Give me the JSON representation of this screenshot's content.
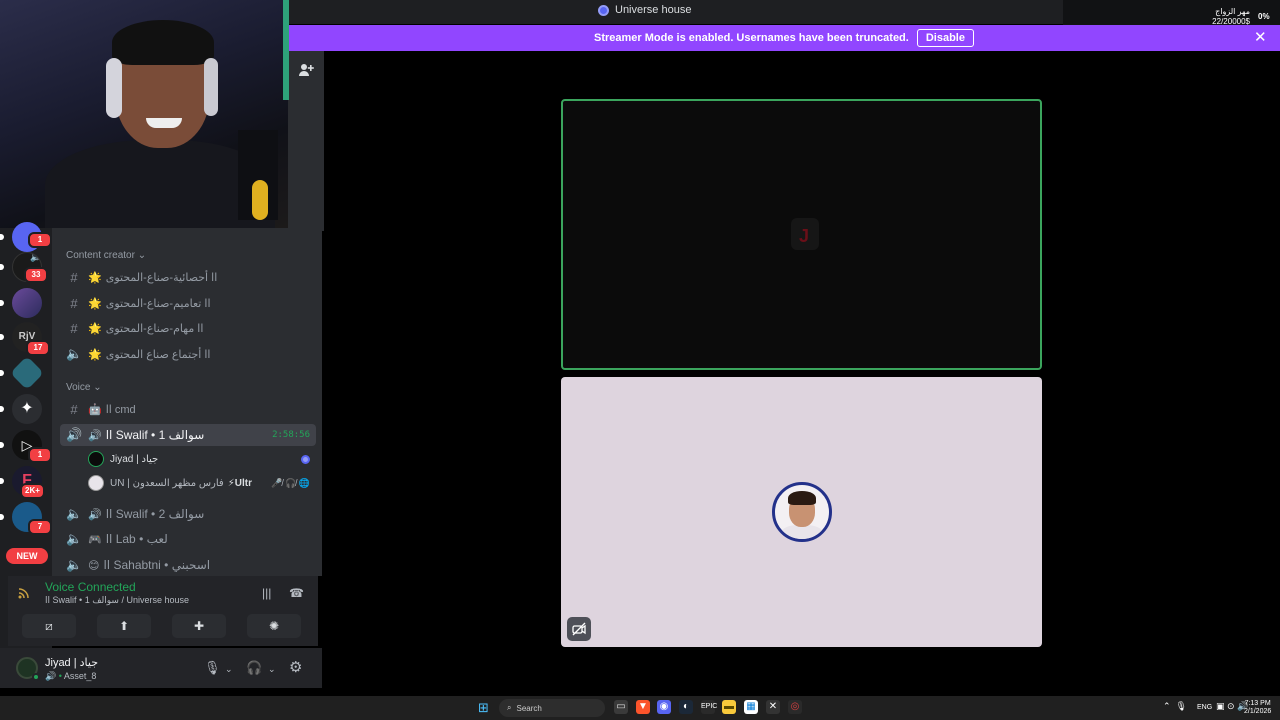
{
  "window": {
    "title": "Universe house"
  },
  "banner": {
    "text": "Streamer Mode is enabled. Usernames have been truncated.",
    "disable_label": "Disable",
    "close_glyph": "✕",
    "color": "#9146ff"
  },
  "overlay": {
    "name": "مهر الزواج",
    "value": "22/20000$",
    "percent": "0%"
  },
  "servers": [
    {
      "badge": "1"
    },
    {
      "badge": "33"
    },
    {
      "badge": ""
    },
    {
      "badge": "17"
    },
    {
      "badge": ""
    },
    {
      "badge": ""
    },
    {
      "badge": "1"
    },
    {
      "badge": "2K+"
    },
    {
      "badge": "7"
    }
  ],
  "new_pill": "NEW",
  "categories": {
    "content_creator": "Content creator",
    "voice": "Voice"
  },
  "channels": {
    "c1": {
      "emoji": "🌟",
      "name": "اا أحصائية-صناع-المحتوى"
    },
    "c2": {
      "emoji": "🌟",
      "name": "اا تعاميم-صناع-المحتوى"
    },
    "c3": {
      "emoji": "🌟",
      "name": "اا مهام-صناع-المحتوى"
    },
    "c4": {
      "emoji": "🌟",
      "name": "اا أجتماع صناع المحتوى"
    },
    "v1": {
      "emoji": "🤖",
      "name": "اا cmd"
    },
    "v2": {
      "emoji": "🔊",
      "name": "اا Swalif • سوالف 1",
      "time": "2:58:56"
    },
    "v3": {
      "emoji": "🔊",
      "name": "اا Swalif • سوالف 2"
    },
    "v4": {
      "emoji": "🎮",
      "name": "اا Lab • لعب"
    },
    "v5": {
      "emoji": "😊",
      "name": "اا Sahabtni • اسحبني"
    }
  },
  "members": [
    {
      "name": "Jiyad | جياد"
    },
    {
      "name": "UN | فارس مظهر السعدون",
      "tag": "⚡Ultr"
    }
  ],
  "voice_panel": {
    "status": "Voice Connected",
    "sub": "اا Swalif • سوالف 1 / Universe house",
    "color": "#23a559"
  },
  "user": {
    "name": "Jiyad | جياد",
    "status": "Asset_8"
  },
  "taskbar": {
    "search": "Search",
    "lang": "ENG",
    "time": "7:13 PM",
    "date": "2/1/2026"
  }
}
